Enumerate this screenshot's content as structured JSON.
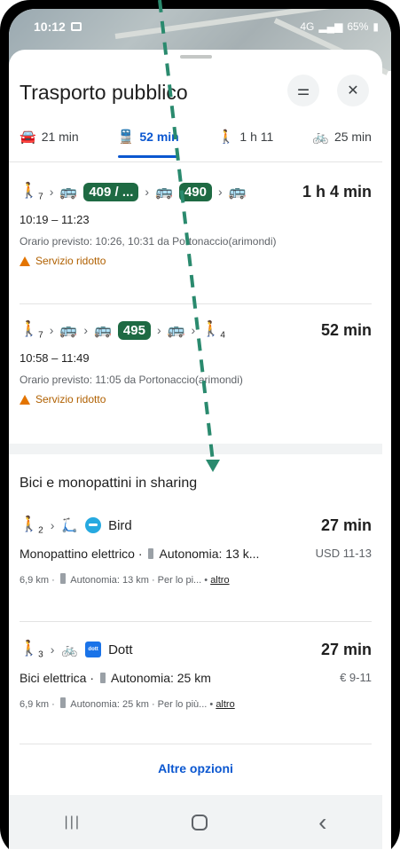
{
  "status_bar": {
    "time": "10:12",
    "battery": "65%",
    "signal_text": "4G"
  },
  "header": {
    "title": "Trasporto pubblico",
    "filter_icon": "sliders-icon",
    "close_icon": "close-icon",
    "close_glyph": "✕",
    "filter_glyph": "⚌"
  },
  "modes": [
    {
      "icon": "car-icon",
      "glyph": "🚘",
      "label": "21 min"
    },
    {
      "icon": "transit-icon",
      "glyph": "🚆",
      "label": "52 min"
    },
    {
      "icon": "walk-icon",
      "glyph": "🚶",
      "label": "1 h 11"
    },
    {
      "icon": "bike-icon",
      "glyph": "🚲",
      "label": "25 min"
    }
  ],
  "routes": [
    {
      "walk_sub": "7",
      "badges": [
        "409 / ...",
        "490"
      ],
      "duration": "1 h 4 min",
      "time": "10:19 – 11:23",
      "schedule": "Orario previsto: 10:26, 10:31 da Portonaccio(arimondi)",
      "warning": "Servizio ridotto"
    },
    {
      "walk_sub": "7",
      "badges": [
        "495"
      ],
      "end_walk_sub": "4",
      "duration": "52 min",
      "time": "10:58 – 11:49",
      "schedule": "Orario previsto: 11:05 da Portonaccio(arimondi)",
      "warning": "Servizio ridotto"
    }
  ],
  "sharing": {
    "heading": "Bici e monopattini in sharing",
    "options": [
      {
        "walk_sub": "2",
        "vehicle_glyph": "🛴",
        "brand": "Bird",
        "logo": "bird-logo",
        "duration": "27 min",
        "vehicle": "Monopattino elettrico ·",
        "autonomy": "Autonomia: 13 k...",
        "price": "USD 11-13",
        "meta": "6,9 km · ",
        "meta_autonomy": "Autonomia: 13 km · Per lo pi...",
        "more": "altro"
      },
      {
        "walk_sub": "3",
        "vehicle_glyph": "🚲",
        "brand": "Dott",
        "logo": "dott-logo",
        "logo_text": "dott",
        "duration": "27 min",
        "vehicle": "Bici elettrica ·",
        "autonomy": "Autonomia: 25 km",
        "price": "€ 9-11",
        "meta": "6,9 km · ",
        "meta_autonomy": "Autonomia: 25 km · Per lo più...",
        "more": "altro"
      }
    ],
    "more_options": "Altre opzioni"
  },
  "nav": {
    "recents_glyph": "|||",
    "back_glyph": "‹"
  },
  "colors": {
    "accent": "#0b57d0",
    "bus_badge": "#1e6a43",
    "warning": "#e37400",
    "annotation": "#2a8a6e"
  }
}
